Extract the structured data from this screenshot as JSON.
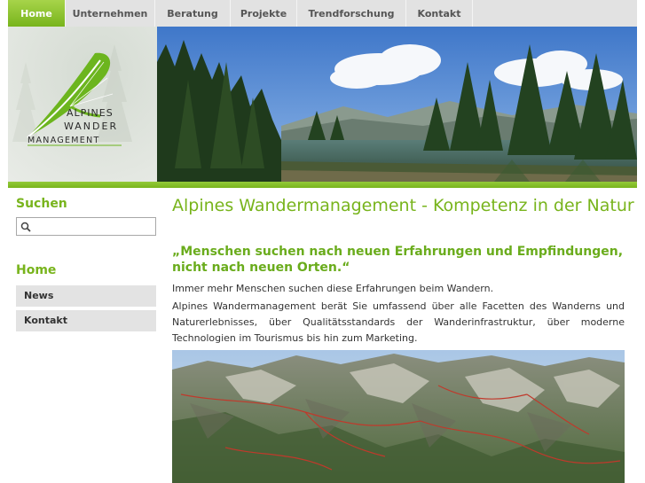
{
  "nav": {
    "items": [
      "Home",
      "Unternehmen",
      "Beratung",
      "Projekte",
      "Trendforschung",
      "Kontakt"
    ],
    "active": "Home"
  },
  "logo": {
    "line1": "ALPINES",
    "line2": "WANDER",
    "line3": "MANAGEMENT"
  },
  "sidebar": {
    "search_title": "Suchen",
    "search_value": "",
    "section_title": "Home",
    "items": [
      "News",
      "Kontakt"
    ]
  },
  "main": {
    "title": "Alpines Wandermanagement - Kompetenz in der Natur",
    "quote": "„Menschen suchen nach neuen Erfahrungen und Empfindungen, nicht nach neuen Orten.“",
    "para1": "Immer mehr Menschen suchen diese Erfahrungen beim Wandern.",
    "para2": "Alpines Wandermanagement berät Sie umfassend über alle Facetten des Wanderns und Naturerlebnisses, über Qualitätsstandards der Wanderinfrastruktur, über moderne Technologien im Tourismus bis hin zum Marketing."
  },
  "colors": {
    "accent": "#78b41c",
    "nav_bg": "#e2e2e2",
    "sidebar_item_bg": "#e3e3e3"
  }
}
